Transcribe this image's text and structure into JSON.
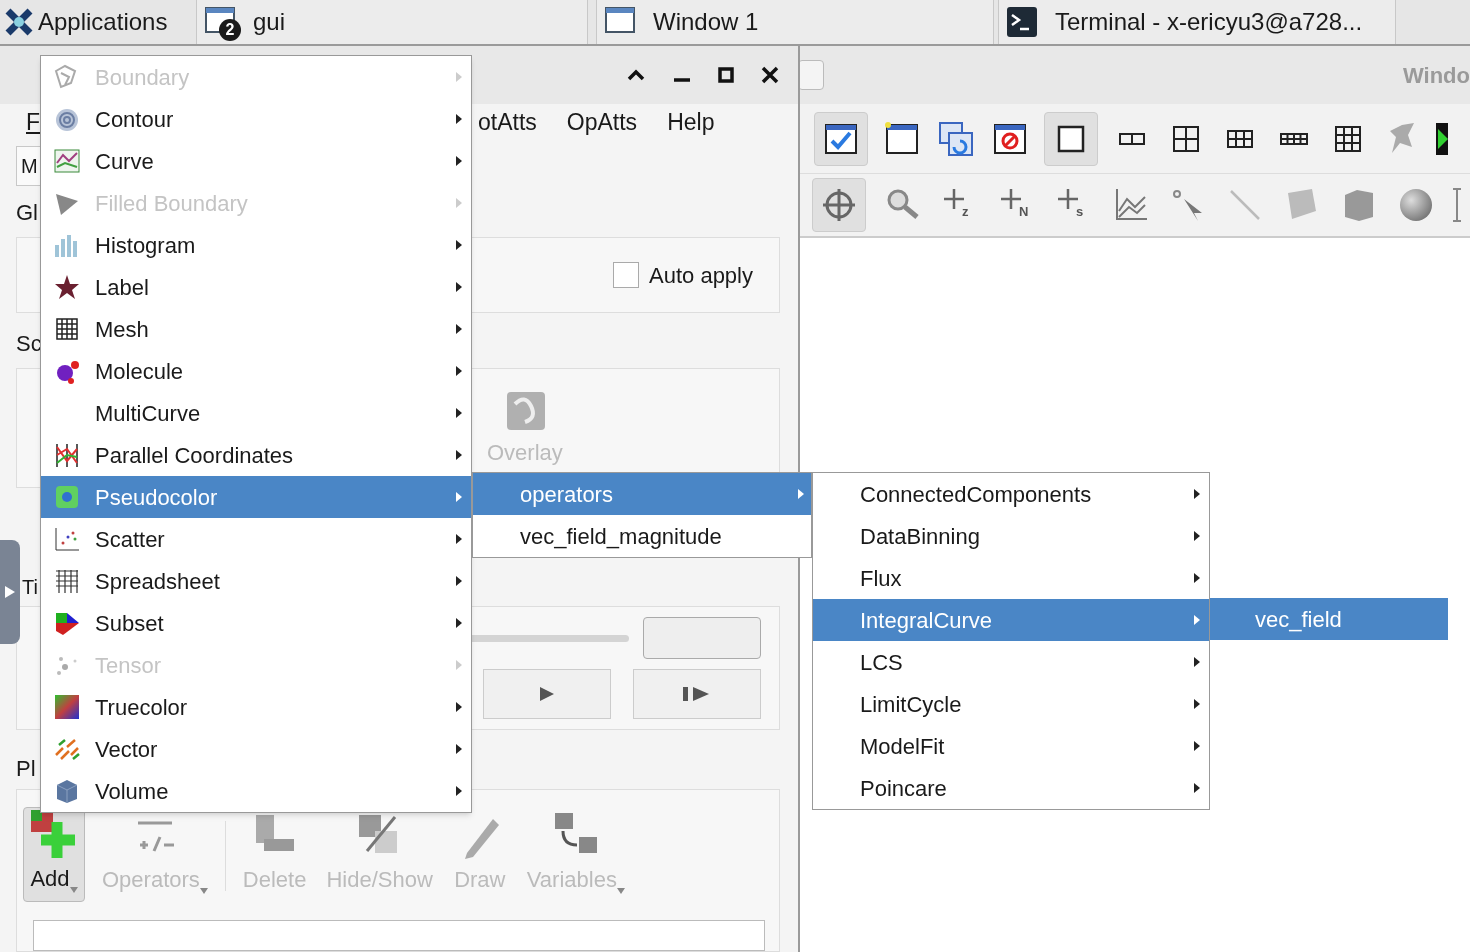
{
  "taskbar": {
    "apps_label": "Applications",
    "tasks": [
      {
        "title": "gui",
        "badge": "2"
      },
      {
        "title": "Window 1"
      },
      {
        "title": "Terminal - x-ericyu3@a728..."
      }
    ]
  },
  "left_window": {
    "menubar": [
      "F",
      "otAtts",
      "OpAtts",
      "Help"
    ],
    "tab_label": "M",
    "section_labels": [
      "Gl",
      "Sc",
      "Ti",
      "Pl"
    ],
    "auto_apply": {
      "label": "Auto apply",
      "checked": false
    },
    "overlay_button": {
      "label": "Overlay",
      "disabled": true
    },
    "plot_toolbar": [
      {
        "label": "Add",
        "disabled": false,
        "dropdown": true
      },
      {
        "label": "Operators",
        "disabled": true,
        "dropdown": true
      },
      {
        "label": "Delete",
        "disabled": true,
        "dropdown": false
      },
      {
        "label": "Hide/Show",
        "disabled": true,
        "dropdown": false
      },
      {
        "label": "Draw",
        "disabled": true,
        "dropdown": false
      },
      {
        "label": "Variables",
        "disabled": true,
        "dropdown": true
      }
    ]
  },
  "right_window": {
    "title": "Windo",
    "pick_labels": [
      "z",
      "N",
      "s"
    ]
  },
  "plot_menu": {
    "items": [
      {
        "label": "Boundary",
        "disabled": true,
        "selected": false
      },
      {
        "label": "Contour",
        "disabled": false,
        "selected": false
      },
      {
        "label": "Curve",
        "disabled": false,
        "selected": false
      },
      {
        "label": "Filled Boundary",
        "disabled": true,
        "selected": false
      },
      {
        "label": "Histogram",
        "disabled": false,
        "selected": false
      },
      {
        "label": "Label",
        "disabled": false,
        "selected": false
      },
      {
        "label": "Mesh",
        "disabled": false,
        "selected": false
      },
      {
        "label": "Molecule",
        "disabled": false,
        "selected": false
      },
      {
        "label": "MultiCurve",
        "disabled": false,
        "selected": false
      },
      {
        "label": "Parallel Coordinates",
        "disabled": false,
        "selected": false
      },
      {
        "label": "Pseudocolor",
        "disabled": false,
        "selected": true
      },
      {
        "label": "Scatter",
        "disabled": false,
        "selected": false
      },
      {
        "label": "Spreadsheet",
        "disabled": false,
        "selected": false
      },
      {
        "label": "Subset",
        "disabled": false,
        "selected": false
      },
      {
        "label": "Tensor",
        "disabled": true,
        "selected": false
      },
      {
        "label": "Truecolor",
        "disabled": false,
        "selected": false
      },
      {
        "label": "Vector",
        "disabled": false,
        "selected": false
      },
      {
        "label": "Volume",
        "disabled": false,
        "selected": false
      }
    ]
  },
  "variable_menu": {
    "items": [
      {
        "label": "operators",
        "selected": true,
        "has_submenu": true
      },
      {
        "label": "vec_field_magnitude",
        "selected": false,
        "has_submenu": false
      }
    ]
  },
  "operators_menu": {
    "items": [
      {
        "label": "ConnectedComponents",
        "selected": false
      },
      {
        "label": "DataBinning",
        "selected": false
      },
      {
        "label": "Flux",
        "selected": false
      },
      {
        "label": "IntegralCurve",
        "selected": true
      },
      {
        "label": "LCS",
        "selected": false
      },
      {
        "label": "LimitCycle",
        "selected": false
      },
      {
        "label": "ModelFit",
        "selected": false
      },
      {
        "label": "Poincare",
        "selected": false
      }
    ]
  },
  "integral_curve_menu": {
    "items": [
      {
        "label": "vec_field",
        "selected": true
      }
    ]
  }
}
